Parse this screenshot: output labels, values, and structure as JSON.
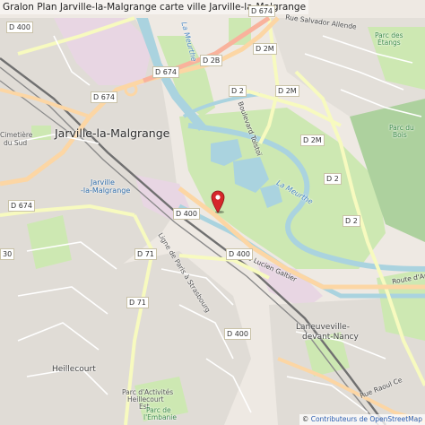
{
  "title": "Gralon Plan Jarville-la-Malgrange carte ville Jarville-la-Malgrange",
  "places": {
    "jarville": "Jarville-la-Malgrange",
    "laneuveville_1": "Laneuveville-",
    "laneuveville_2": "devant-Nancy",
    "heillecourt": "Heillecourt",
    "cimetiere_1": "Cimetière",
    "cimetiere_2": "du Sud",
    "station_1": "Jarville",
    "station_2": "-la-Malgrange",
    "parc_etangs_1": "Parc des",
    "parc_etangs_2": "Étangs",
    "parc_bois_1": "Parc du",
    "parc_bois_2": "Bois",
    "pa_1": "Parc d'Activités",
    "pa_2": "Heillecourt",
    "pa_3": "Est",
    "embanie_1": "Parc de",
    "embanie_2": "l'Embanie"
  },
  "roads": {
    "d674_top": "D 674",
    "d674_mid": "D 674",
    "d674_left": "D 674",
    "d674_lower": "D 674",
    "d400_top": "D 400",
    "d400_mid": "D 400",
    "d400_low": "D 400",
    "d2b": "D 2B",
    "d2m_1": "D 2M",
    "d2m_2": "D 2M",
    "d2m_3": "D 2M",
    "d2_1": "D 2",
    "d2_2": "D 2",
    "d2_3": "D 2",
    "d71_1": "D 71",
    "d71_2": "D 71",
    "a30": "30"
  },
  "streets": {
    "salvador": "Rue Salvador Allende",
    "tolstoi": "Boulevard Tolstoï",
    "lucien": "Rue Lucien Galtier",
    "arts": "Route d'Art",
    "raoul": "Rue Raoul Ce",
    "paris_strasbourg": "Ligne de Paris à Strasbourg"
  },
  "water": {
    "meurthe_1": "La Meurthe",
    "meurthe_2": "La Meurthe"
  },
  "attribution": {
    "prefix": "© ",
    "link": "Contributeurs de OpenStreetMap"
  },
  "colors": {
    "background": "#eee9e3",
    "residential": "#e0dcd6",
    "industrial": "#e8d6e3",
    "park": "#cde8b2",
    "forest": "#add19e",
    "water": "#aad3df",
    "primary_road": "#fcd6a4",
    "trunk_road": "#f9b29c",
    "secondary_road": "#f7fabf",
    "railway": "#707070",
    "marker": "#d6272b"
  }
}
